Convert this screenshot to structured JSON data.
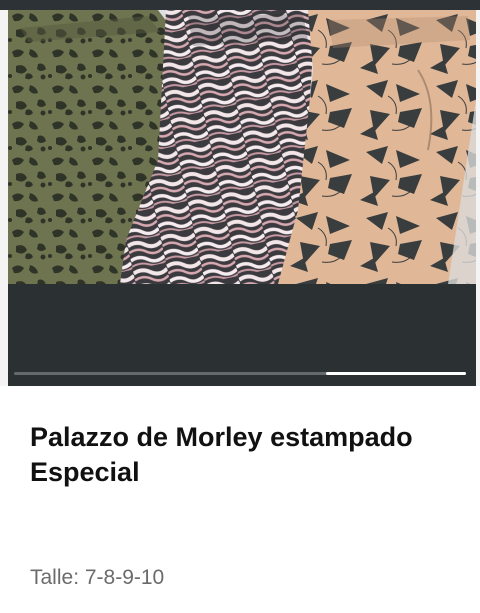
{
  "product": {
    "title_line1": "Palazzo de Morley estampado",
    "title_line2": "Especial",
    "size_text": "Talle: 7-8-9-10"
  },
  "gallery": {
    "image_icon": "product-photo",
    "image_count": 3,
    "active_index": 3,
    "progress_fraction_start": 0.69,
    "progress_fraction_end": 1.0
  },
  "colors": {
    "dark_panel": "#2b3133",
    "progress_track": "#646a6d",
    "progress_fill": "#ffffff",
    "title": "#111111",
    "subtitle": "#6b6b6b"
  }
}
